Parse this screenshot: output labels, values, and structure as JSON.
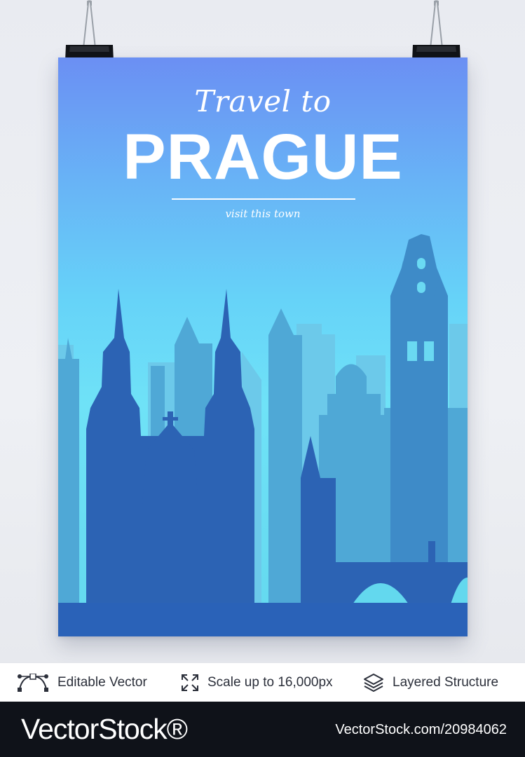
{
  "poster": {
    "kicker": "Travel to",
    "city": "PRAGUE",
    "tagline": "visit this town"
  },
  "features": [
    {
      "icon": "bezier-curve-icon",
      "label": "Editable Vector"
    },
    {
      "icon": "expand-arrows-icon",
      "label": "Scale up to 16,000px"
    },
    {
      "icon": "layers-icon",
      "label": "Layered Structure"
    }
  ],
  "footer": {
    "brand": "VectorStock®",
    "image_id": "VectorStock.com/20984062"
  },
  "colors": {
    "sky_top": "#6b8ff3",
    "sky_bottom": "#66d8f0",
    "skyline_back": "#6cc9ea",
    "skyline_mid": "#4aa2d2",
    "skyline_front": "#2c63b4",
    "ground": "#2a62b8",
    "footer_bg": "#0f1219"
  }
}
